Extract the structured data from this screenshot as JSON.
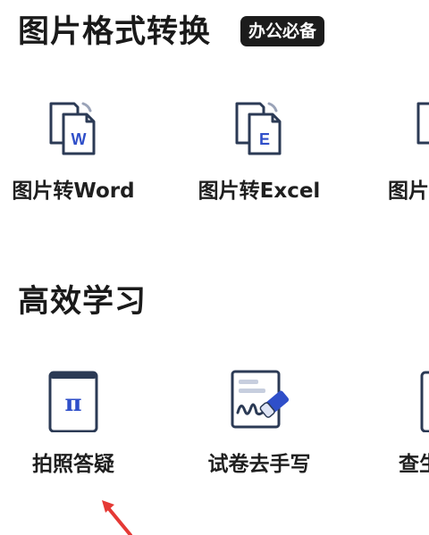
{
  "sections": [
    {
      "title": "图片格式转换",
      "badge": "办公必备",
      "tools": [
        {
          "label": "图片转Word",
          "icon": "word-doc-icon",
          "letter": "W"
        },
        {
          "label": "图片转Excel",
          "icon": "excel-doc-icon",
          "letter": "E"
        },
        {
          "label": "图片",
          "icon": "doc-icon"
        }
      ]
    },
    {
      "title": "高效学习",
      "tools": [
        {
          "label": "拍照答疑",
          "icon": "phone-pi-icon",
          "symbol": "π"
        },
        {
          "label": "试卷去手写",
          "icon": "paper-eraser-icon"
        },
        {
          "label": "查生",
          "icon": "search-icon"
        }
      ]
    }
  ],
  "colors": {
    "accent": "#2f4fc9",
    "icon_outline": "#2b3a55",
    "arrow": "#e53935"
  }
}
